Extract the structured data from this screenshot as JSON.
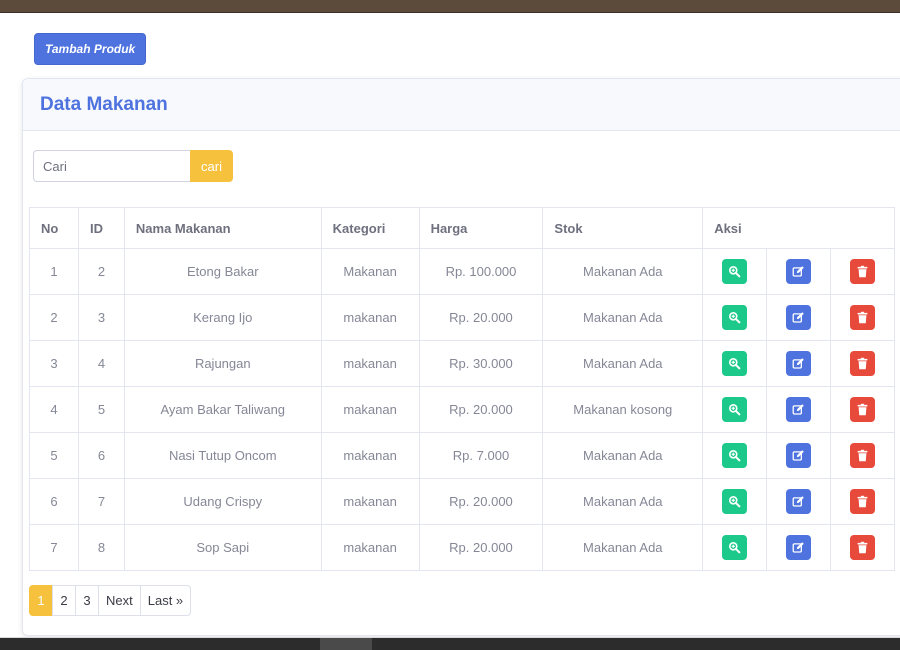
{
  "toolbar": {
    "add_label": "Tambah Produk"
  },
  "card": {
    "title": "Data Makanan"
  },
  "search": {
    "placeholder": "Cari",
    "button_label": "cari"
  },
  "table": {
    "headers": [
      "No",
      "ID",
      "Nama Makanan",
      "Kategori",
      "Harga",
      "Stok",
      "Aksi"
    ],
    "rows": [
      [
        "1",
        "2",
        "Etong Bakar",
        "Makanan",
        "Rp. 100.000",
        "Makanan Ada"
      ],
      [
        "2",
        "3",
        "Kerang Ijo",
        "makanan",
        "Rp. 20.000",
        "Makanan Ada"
      ],
      [
        "3",
        "4",
        "Rajungan",
        "makanan",
        "Rp. 30.000",
        "Makanan Ada"
      ],
      [
        "4",
        "5",
        "Ayam Bakar Taliwang",
        "makanan",
        "Rp. 20.000",
        "Makanan kosong"
      ],
      [
        "5",
        "6",
        "Nasi Tutup Oncom",
        "makanan",
        "Rp. 7.000",
        "Makanan Ada"
      ],
      [
        "6",
        "7",
        "Udang Crispy",
        "makanan",
        "Rp. 20.000",
        "Makanan Ada"
      ],
      [
        "7",
        "8",
        "Sop Sapi",
        "makanan",
        "Rp. 20.000",
        "Makanan Ada"
      ]
    ],
    "actions": [
      {
        "name": "view-button",
        "icon": "search-plus-icon",
        "color": "#1cc88a"
      },
      {
        "name": "edit-button",
        "icon": "edit-icon",
        "color": "#4e73df"
      },
      {
        "name": "delete-button",
        "icon": "trash-icon",
        "color": "#e74a3b"
      }
    ]
  },
  "pagination": {
    "pages": [
      "1",
      "2",
      "3"
    ],
    "active": "1",
    "next_label": "Next",
    "last_label": "Last »"
  },
  "colors": {
    "primary": "#4e73df",
    "warning": "#f6c23e",
    "success": "#1cc88a",
    "danger": "#e74a3b"
  }
}
